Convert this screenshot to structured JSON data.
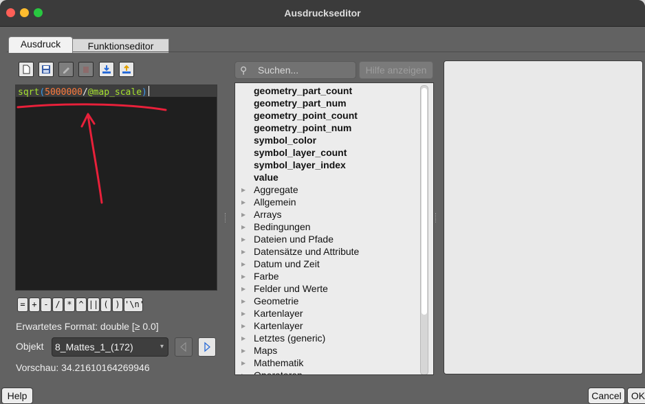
{
  "window": {
    "title": "Ausdruckseditor"
  },
  "tabs": [
    {
      "label": "Ausdruck",
      "active": true
    },
    {
      "label": "Funktionseditor",
      "active": false
    }
  ],
  "toolbar": {
    "buttons": [
      {
        "icon": "new-file-icon",
        "enabled": true
      },
      {
        "icon": "save-icon",
        "enabled": true
      },
      {
        "icon": "edit-icon",
        "enabled": false
      },
      {
        "icon": "delete-icon",
        "enabled": false
      },
      {
        "icon": "import-icon",
        "enabled": true
      },
      {
        "icon": "export-icon",
        "enabled": true
      }
    ]
  },
  "editor": {
    "expression": {
      "func": "sqrt",
      "open": "(",
      "number": "5000000",
      "op": "/",
      "variable": "@map_scale",
      "close": ")"
    }
  },
  "operators": [
    "=",
    "+",
    "-",
    "/",
    "*",
    "^",
    "||",
    "(",
    ")",
    "'\\n'"
  ],
  "format": {
    "label": "Erwartetes Format:",
    "value": "double [≥ 0.0]"
  },
  "object": {
    "label": "Objekt",
    "value": "8_Mattes_1_(172)"
  },
  "preview": {
    "label": "Vorschau:",
    "value": "34.21610164269946"
  },
  "search": {
    "placeholder": "Suchen...",
    "help_button": "Hilfe anzeigen"
  },
  "functions": {
    "variables": [
      "geometry_part_count",
      "geometry_part_num",
      "geometry_point_count",
      "geometry_point_num",
      "symbol_color",
      "symbol_layer_count",
      "symbol_layer_index",
      "value"
    ],
    "groups": [
      "Aggregate",
      "Allgemein",
      "Arrays",
      "Bedingungen",
      "Dateien und Pfade",
      "Datensätze und Attribute",
      "Datum und Zeit",
      "Farbe",
      "Felder und Werte",
      "Geometrie",
      "Kartenlayer",
      "Kartenlayer",
      "Letztes (generic)",
      "Maps",
      "Mathematik",
      "Operatoren"
    ]
  },
  "bottom": {
    "help": "Help",
    "cancel": "Cancel",
    "ok": "OK"
  },
  "colors": {
    "code_function": "#a6e22e",
    "code_number": "#ff7a3d",
    "code_paren": "#3a9cf0",
    "annotation": "#e8203a"
  }
}
